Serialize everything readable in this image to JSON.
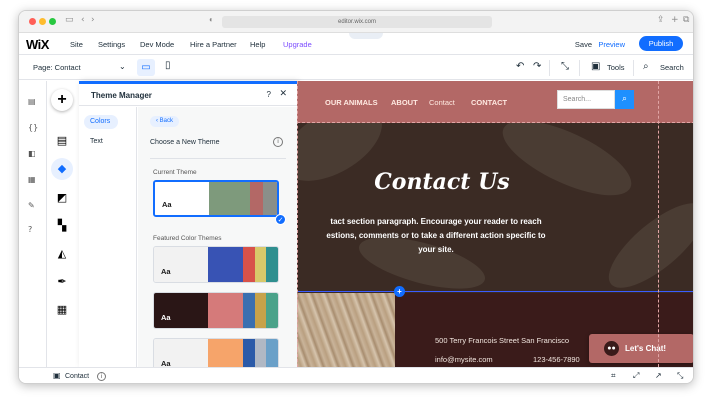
{
  "browser": {
    "url": "editor.wix.com"
  },
  "wix_top": {
    "logo": "WiX",
    "menu": [
      "Site",
      "Settings",
      "Dev Mode",
      "Hire a Partner",
      "Help"
    ],
    "upgrade": "Upgrade",
    "save": "Save",
    "preview": "Preview",
    "publish": "Publish"
  },
  "toolbar": {
    "page_label": "Page: Contact",
    "tools_label": "Tools",
    "search_label": "Search"
  },
  "theme_manager": {
    "title": "Theme Manager",
    "help": "?",
    "nav": [
      "Colors",
      "Text"
    ],
    "back": "Back",
    "choose_label": "Choose a New Theme",
    "current_theme_label": "Current Theme",
    "featured_label": "Featured Color Themes",
    "aa": "Aa",
    "themes": [
      {
        "bg": "#ffffff",
        "text": "#1a1a1a",
        "colors": [
          "#7e9a7c",
          "#7e9a7c",
          "#b36866",
          "#8a8f8a"
        ]
      },
      {
        "bg": "#f2f2f2",
        "text": "#1a1a1a",
        "colors": [
          "#3853b4",
          "#3853b4",
          "#d8524a",
          "#d8c96a",
          "#2f8f8f"
        ]
      },
      {
        "bg": "#2a1616",
        "text": "#ffffff",
        "colors": [
          "#d57a7a",
          "#d57a7a",
          "#3a6fb0",
          "#c7a24a",
          "#4aa28a"
        ]
      },
      {
        "bg": "#f2f2f2",
        "text": "#1a1a1a",
        "colors": [
          "#f6a46a",
          "#f6a46a",
          "#2b5aa8",
          "#b0b8c4",
          "#6aa0c8"
        ]
      }
    ]
  },
  "site": {
    "nav": [
      "OUR ANIMALS",
      "ABOUT",
      "Contact",
      "CONTACT"
    ],
    "search_placeholder": "Search...",
    "hero_title": "Contact Us",
    "hero_paragraph_lines": [
      "tact section paragraph. Encourage your reader to reach",
      "estions, comments or to take a different action specific to",
      "your site."
    ],
    "address": "500 Terry Francois Street San Francisco",
    "email": "info@mysite.com",
    "phone": "123-456-7890",
    "chat_label": "Let's Chat!"
  },
  "bottom_bar": {
    "page_name": "Contact"
  },
  "colors": {
    "accent": "#116dff",
    "site_header": "#b36866",
    "hero_bg": "#3b2b24"
  }
}
